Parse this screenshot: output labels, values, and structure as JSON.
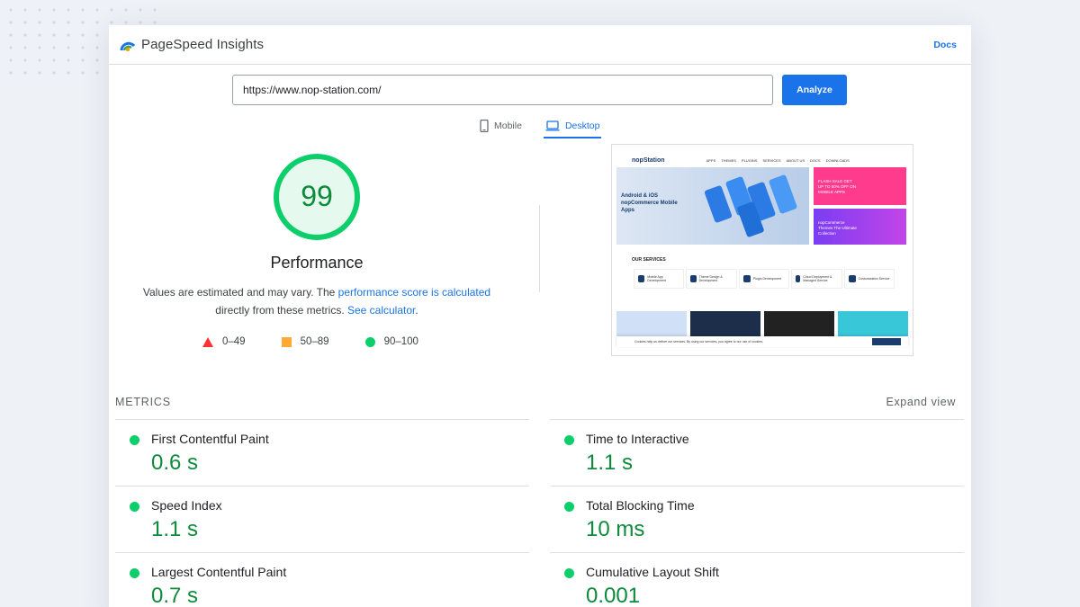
{
  "app": {
    "title": "PageSpeed Insights",
    "docs_label": "Docs"
  },
  "search": {
    "url": "https://www.nop-station.com/",
    "analyze_label": "Analyze"
  },
  "tabs": [
    {
      "label": "Mobile",
      "icon": "phone-icon",
      "active": false
    },
    {
      "label": "Desktop",
      "icon": "laptop-icon",
      "active": true
    }
  ],
  "performance": {
    "score": "99",
    "score_fraction": 0.99,
    "title": "Performance",
    "desc_prefix": "Values are estimated and may vary. The ",
    "desc_link1": "performance score is calculated",
    "desc_middle": "directly from these metrics. ",
    "desc_link2": "See calculator",
    "desc_suffix": "."
  },
  "legend": [
    {
      "range": "0–49",
      "shape": "triangle",
      "color": "#ff3333"
    },
    {
      "range": "50–89",
      "shape": "square",
      "color": "#ffaa33"
    },
    {
      "range": "90–100",
      "shape": "circle",
      "color": "#0cce6b"
    }
  ],
  "metrics_section": {
    "label": "METRICS",
    "expand_label": "Expand view"
  },
  "metrics": [
    {
      "name": "First Contentful Paint",
      "value": "0.6 s"
    },
    {
      "name": "Time to Interactive",
      "value": "1.1 s"
    },
    {
      "name": "Speed Index",
      "value": "1.1 s"
    },
    {
      "name": "Total Blocking Time",
      "value": "10 ms"
    },
    {
      "name": "Largest Contentful Paint",
      "value": "0.7 s"
    },
    {
      "name": "Cumulative Layout Shift",
      "value": "0.001"
    }
  ],
  "screenshot_preview": {
    "logo": "nopStation",
    "nav": [
      "APPS",
      "THEMES",
      "PLUGINS",
      "SERVICES",
      "ABOUT US",
      "DOCS",
      "DOWNLOADS"
    ],
    "hero_text": "Android & iOS nopCommerce Mobile Apps",
    "side1_text": "FLASH SALE GET UP TO 50% OFF ON MOBILE APPS",
    "side2_text": "nopCommerce Themes The Ultimate Collection",
    "services_title": "OUR SERVICES",
    "services": [
      "Mobile App Development",
      "Theme Design & Development",
      "Plugin Development",
      "Cloud Deployment & Managed Service",
      "Customization Service"
    ],
    "cookie_text": "Cookies help us deliver our services. By using our services, you agree to our use of cookies."
  },
  "colors": {
    "accent": "#1a73e8",
    "good": "#0cce6b",
    "good_text": "#0c8b3b"
  }
}
